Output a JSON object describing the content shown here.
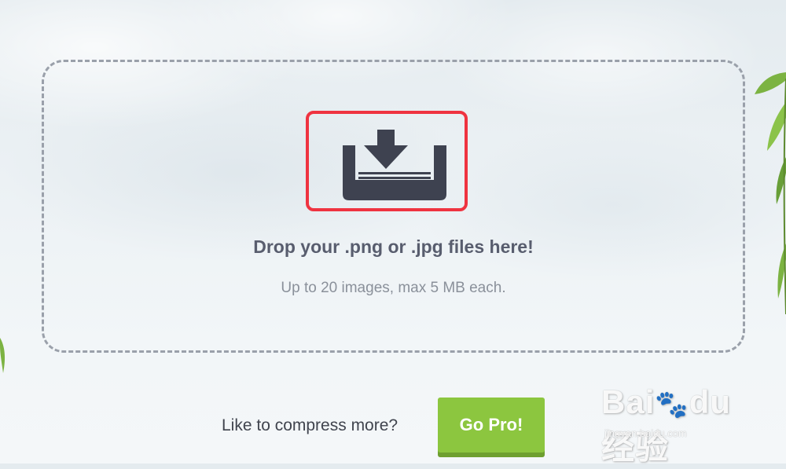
{
  "dropzone": {
    "title": "Drop your .png or .jpg files here!",
    "subtitle": "Up to 20 images, max 5 MB each.",
    "highlight_color": "#ef3340",
    "icon": "upload-tray-icon"
  },
  "promo": {
    "text": "Like to compress more?",
    "button_label": "Go Pro!",
    "button_color": "#8cc63f"
  },
  "watermark": {
    "logo": "Bai du 经验",
    "url": "jingyan.baidu.com"
  }
}
